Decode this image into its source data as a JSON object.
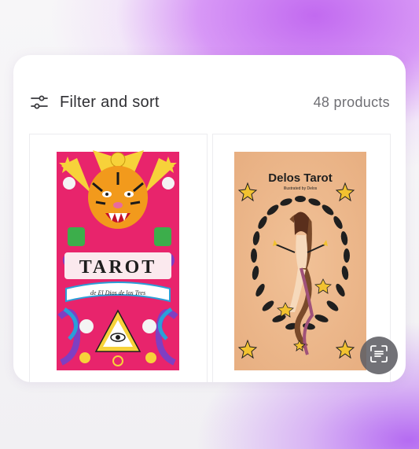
{
  "toolbar": {
    "filter_label": "Filter and sort",
    "filter_icon": "sliders-icon",
    "product_count": "48 products"
  },
  "products": [
    {
      "cover_title": "TAROT",
      "cover_subtitle": "de El Dios de los Tres",
      "cover_colors": [
        "#e8246c",
        "#f7d23a",
        "#2a9fd8",
        "#3cae4b"
      ]
    },
    {
      "cover_title": "Delos Tarot",
      "cover_subtitle": "Illustrated by Delos",
      "cover_colors": [
        "#efb98c",
        "#1f1f1f",
        "#f2c230"
      ]
    }
  ],
  "fab": {
    "icon": "scan-text-icon"
  }
}
